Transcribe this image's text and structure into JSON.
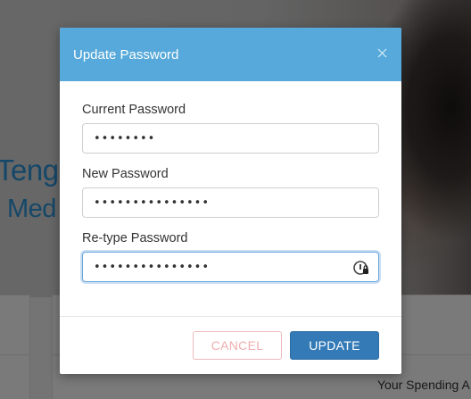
{
  "background": {
    "name_fragment": "Teng",
    "role_fragment": "Med",
    "footer_text": "Your Spending A"
  },
  "modal": {
    "title": "Update Password",
    "close_icon": "close-icon",
    "fields": [
      {
        "label": "Current Password",
        "value": "••••••••"
      },
      {
        "label": "New Password",
        "value": "•••••••••••••••"
      },
      {
        "label": "Re-type Password",
        "value": "•••••••••••••••",
        "icon": "password-manager-key-icon"
      }
    ],
    "buttons": {
      "cancel_label": "CANCEL",
      "update_label": "UPDATE"
    }
  },
  "colors": {
    "header": "#56a9da",
    "primary_button": "#337ab7",
    "cancel_text": "#f0aeb0"
  }
}
